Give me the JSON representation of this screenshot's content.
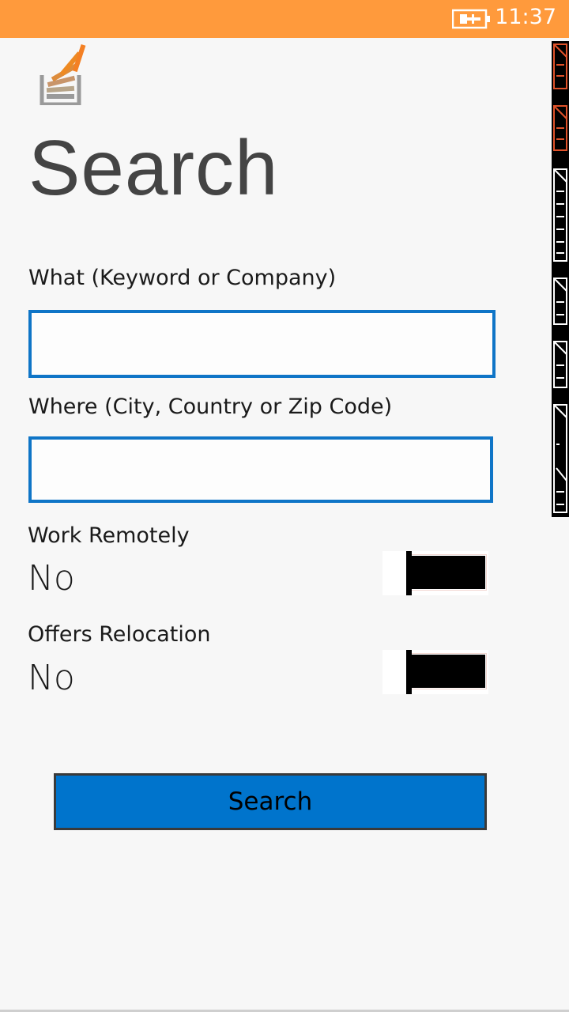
{
  "status_bar": {
    "time": "11:37",
    "background": "#ff9a3c",
    "icons": [
      "battery-charging-icon"
    ]
  },
  "app": {
    "logo_icon": "stackoverflow-logo-icon"
  },
  "page": {
    "title": "Search"
  },
  "form": {
    "what": {
      "label": "What (Keyword or Company)",
      "value": "",
      "placeholder": ""
    },
    "where": {
      "label": "Where (City, Country or Zip Code)",
      "value": "",
      "placeholder": ""
    },
    "work_remotely": {
      "label": "Work Remotely",
      "value": "No"
    },
    "offers_relocation": {
      "label": "Offers Relocation",
      "value": "No"
    },
    "submit_label": "Search"
  },
  "colors": {
    "accent": "#0f75c7",
    "button": "#0074cc",
    "status_bar": "#ff9a3c",
    "title_text": "#444444"
  }
}
